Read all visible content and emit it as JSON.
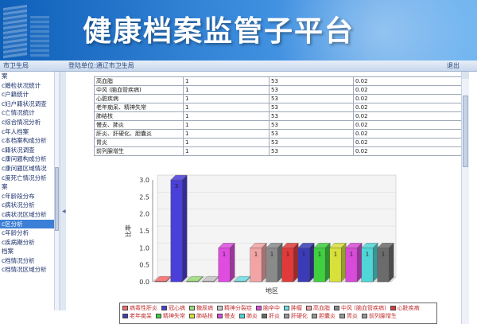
{
  "app": {
    "title": "健康档案监管子平台"
  },
  "status": {
    "org": "市卫生局",
    "unit": "登陆单位:通辽市卫生局",
    "logout": "退出"
  },
  "sidebar": {
    "items": [
      "案",
      "c婚检状况统计",
      "c户籍统计",
      "c妇户籍状况调查",
      "c亡情况统计",
      "c综合情况分析",
      "c年人档案",
      "c本档案构成分析",
      "c籍状况调查",
      "c康问题构成分析",
      "c康问题区域情况",
      "c度死亡情况分析",
      "案",
      "c年龄段分布",
      "c病状况分析",
      "c病状况区域分析",
      "c区分析",
      "c年龄分析",
      "c疾病期分析",
      "档案",
      "c档情况分析",
      "c档情况区域分析"
    ],
    "active_index": 16
  },
  "table": {
    "rows": [
      [
        "高血脂",
        "1",
        "53",
        "0.02"
      ],
      [
        "中风 (脑血管疾病)",
        "1",
        "53",
        "0.02"
      ],
      [
        "心脏疾病",
        "1",
        "53",
        "0.02"
      ],
      [
        "老年痴呆、精神失常",
        "1",
        "53",
        "0.02"
      ],
      [
        "肺结核",
        "1",
        "53",
        "0.02"
      ],
      [
        "慢支、肺炎",
        "1",
        "53",
        "0.02"
      ],
      [
        "肝炎、肝硬化、胆囊炎",
        "1",
        "53",
        "0.02"
      ],
      [
        "胃炎",
        "1",
        "53",
        "0.02"
      ],
      [
        "前列腺增生",
        "1",
        "53",
        "0.02"
      ]
    ]
  },
  "chart_data": {
    "type": "bar",
    "xlabel": "地区",
    "ylabel": "比率",
    "ylim": [
      0,
      3.0
    ],
    "yticks": [
      "0.0",
      "0.5",
      "1.0",
      "1.5",
      "2.0",
      "2.5",
      "3.0"
    ],
    "series": [
      {
        "name": "病毒性肝炎",
        "value": 0,
        "label": "",
        "color": "#ff6a6a"
      },
      {
        "name": "冠心病",
        "value": 3,
        "label": "3",
        "color": "#4a3fd8"
      },
      {
        "name": "糖尿病",
        "value": 0,
        "label": "",
        "color": "#9be07a"
      },
      {
        "name": "精神分裂症",
        "value": 0,
        "label": "",
        "color": "#c8c8c8"
      },
      {
        "name": "脑卒中",
        "value": 1,
        "label": "1",
        "color": "#e04ce0"
      },
      {
        "name": "肿瘤",
        "value": 0,
        "label": "",
        "color": "#6fe0e8"
      },
      {
        "name": "高血脂",
        "value": 1,
        "label": "1",
        "color": "#f2a4a4"
      },
      {
        "name": "中风 (脑血管疾病)",
        "value": 1,
        "label": "1",
        "color": "#8a8a8a"
      },
      {
        "name": "心脏疾病",
        "value": 1,
        "label": "1",
        "color": "#e23a3a"
      },
      {
        "name": "老年痴呆、精神失常",
        "value": 1,
        "label": "1",
        "color": "#3b3bb8"
      },
      {
        "name": "肺结核",
        "value": 1,
        "label": "1",
        "color": "#3fcf3f"
      },
      {
        "name": "慢支、肺炎",
        "value": 1,
        "label": "1",
        "color": "#d8e03a"
      },
      {
        "name": "肝炎、肝硬化、胆囊炎",
        "value": 1,
        "label": "1",
        "color": "#d84ad8"
      },
      {
        "name": "胃炎",
        "value": 1,
        "label": "1",
        "color": "#4fd6d6"
      },
      {
        "name": "前列腺增生",
        "value": 1,
        "label": "1",
        "color": "#6b6b6b"
      }
    ],
    "legend": [
      "病毒性肝炎",
      "冠心病",
      "糖尿病",
      "精神分裂症",
      "脑卒中",
      "肿瘤",
      "高血脂",
      "中风 (脑血管疾病)",
      "心脏疾病",
      "老年痴呆",
      "精神失常",
      "肺结核",
      "慢支",
      "肺炎",
      "肝炎",
      "肝硬化",
      "胆囊炎",
      "胃炎",
      "前列腺增生"
    ]
  }
}
